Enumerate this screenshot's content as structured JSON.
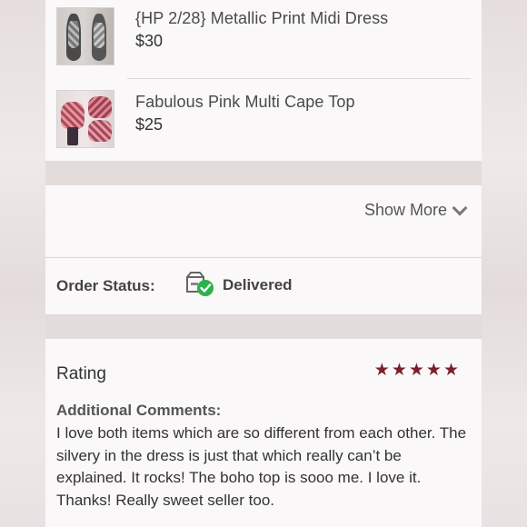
{
  "order_items": [
    {
      "title": "{HP 2/28} Metallic Print Midi Dress",
      "price": "$30",
      "thumbnail_icon": "dress-photo"
    },
    {
      "title": "Fabulous Pink Multi Cape Top",
      "price": "$25",
      "thumbnail_icon": "cape-top-photo"
    }
  ],
  "show_more": {
    "label": "Show More",
    "icon": "chevron-down-icon"
  },
  "order_status": {
    "label": "Order Status:",
    "value": "Delivered",
    "icon": "delivered-box-icon"
  },
  "rating": {
    "title": "Rating",
    "stars": 5,
    "star_color": "#7a1f2e",
    "comments_label": "Additional Comments:",
    "comments": "I love both items which are so different from each other. The silvery in the dress is just that which really can’t be explained. It rocks! The boho top is sooo me. I love it. Thanks! Really sweet seller too."
  },
  "colors": {
    "accent": "#7a1f2e",
    "check_green": "#2bb24c"
  }
}
